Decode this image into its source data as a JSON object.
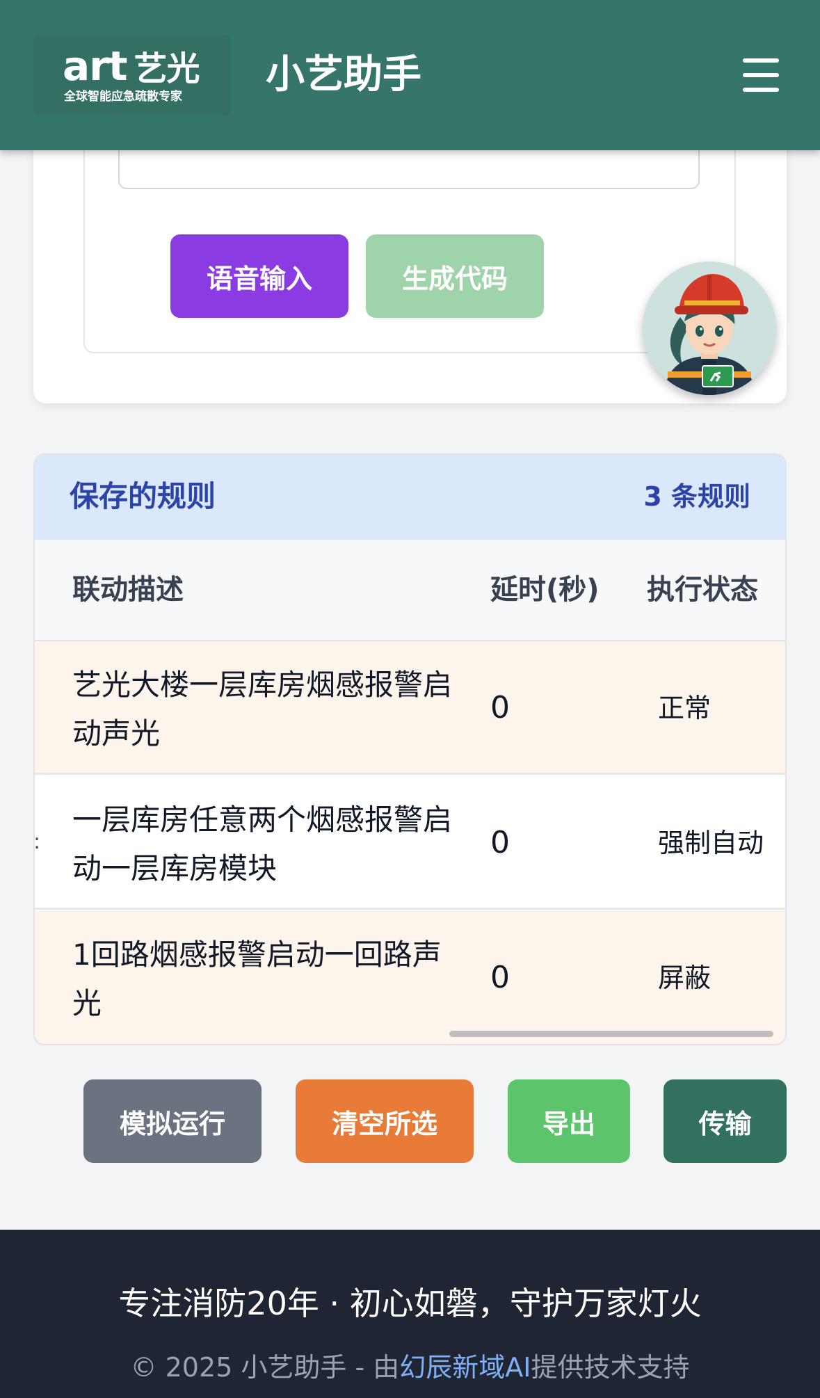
{
  "header": {
    "logo_main": "art",
    "logo_cn": "艺光",
    "logo_tagline": "全球智能应急疏散专家",
    "title": "小艺助手"
  },
  "actions": {
    "voice_input": "语音输入",
    "generate_code": "生成代码"
  },
  "rules": {
    "title": "保存的规则",
    "count": "3 条规则",
    "columns": [
      "联动描述",
      "延时(秒)",
      "执行状态"
    ],
    "rows": [
      {
        "description": "艺光大楼一层库房烟感报警启动声光",
        "delay": "0",
        "status": "正常"
      },
      {
        "description": "一层库房任意两个烟感报警启动一层库房模块",
        "delay": "0",
        "status": "强制自动"
      },
      {
        "description": "1回路烟感报警启动一回路声光",
        "delay": "0",
        "status": "屏蔽"
      }
    ]
  },
  "bottom_actions": {
    "simulate": "模拟运行",
    "clear": "清空所选",
    "export": "导出",
    "transfer": "传输"
  },
  "footer": {
    "slogan": "专注消防20年 · 初心如磐，守护万家灯火",
    "copyright_prefix": "© 2025 小艺助手 - 由",
    "copyright_link": "幻辰新域AI",
    "copyright_suffix": "提供技术支持"
  },
  "colors": {
    "header_bg": "#35756a",
    "voice_button": "#8a3be2",
    "generate_button": "#9fd3a9",
    "simulate_button": "#6b7280",
    "clear_button": "#e87b38",
    "export_button": "#5cc46a",
    "transfer_button": "#32715f",
    "footer_bg": "#1f2533"
  }
}
